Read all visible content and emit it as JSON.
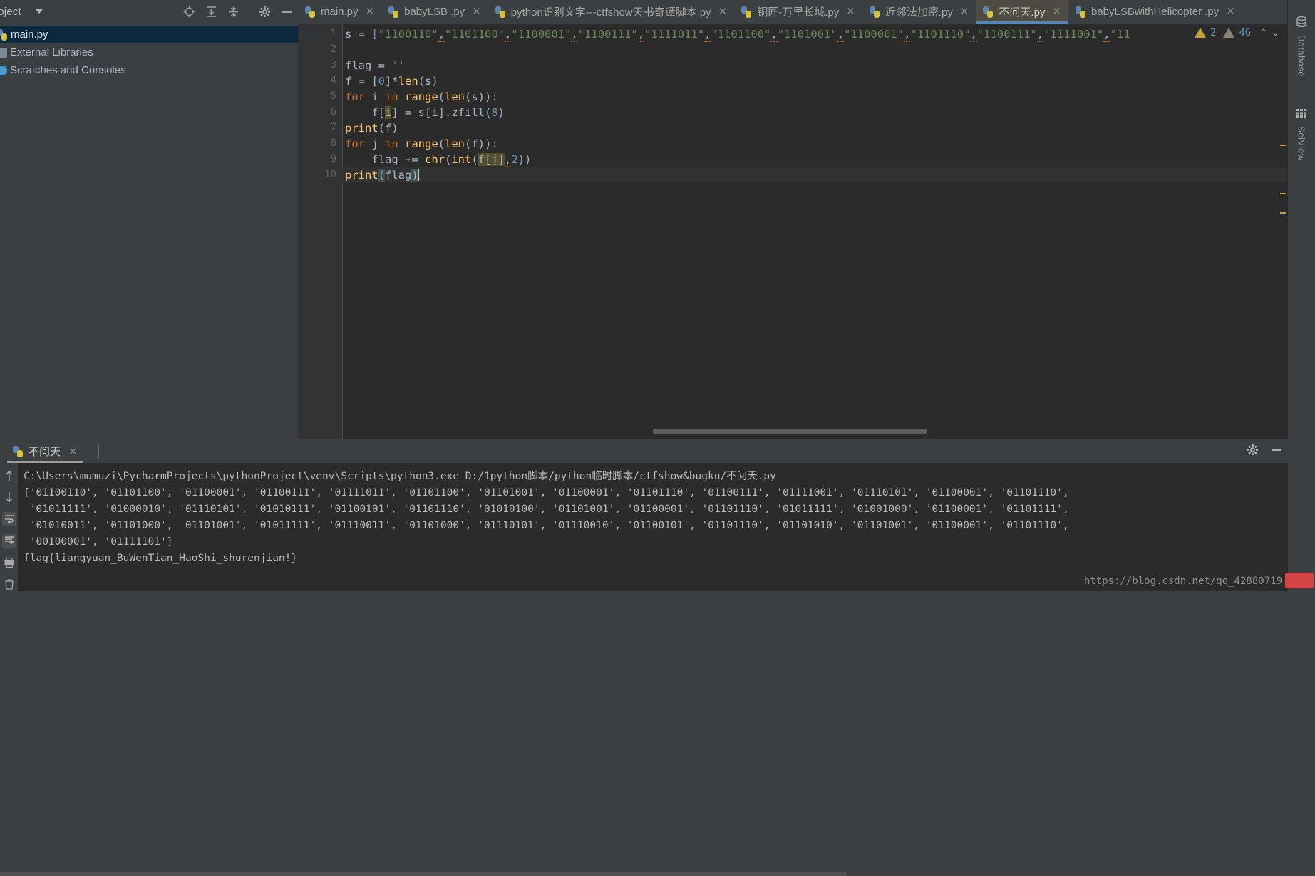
{
  "project_panel": {
    "title": "roject",
    "caret_icon": "chevron-down-icon",
    "toolbar": [
      {
        "name": "locate-icon",
        "glyph": "⊕"
      },
      {
        "name": "expand-all-icon",
        "glyph": "⤓"
      },
      {
        "name": "collapse-all-icon",
        "glyph": "⤒"
      },
      {
        "name": "settings-gear-icon",
        "glyph": "✷"
      },
      {
        "name": "hide-panel-icon",
        "glyph": "—"
      }
    ],
    "tree": [
      {
        "label": "main.py",
        "icon": "python-file-icon",
        "selected": true
      },
      {
        "label": "External Libraries",
        "icon": "library-icon",
        "selected": false
      },
      {
        "label": "Scratches and Consoles",
        "icon": "scratches-icon",
        "selected": false
      }
    ]
  },
  "editor_tabs": [
    {
      "label": "main.py",
      "active": false
    },
    {
      "label": "babyLSB .py",
      "active": false
    },
    {
      "label": "python识别文字---ctfshow天书奇谭脚本.py",
      "active": false
    },
    {
      "label": "铜匠-万里长城.py",
      "active": false
    },
    {
      "label": "近邻法加密.py",
      "active": false
    },
    {
      "label": "不问天.py",
      "active": true
    },
    {
      "label": "babyLSBwithHelicopter .py",
      "active": false
    }
  ],
  "inspection_widget": {
    "warning_count": "2",
    "weak_warning_count": "46",
    "prev_icon": "chevron-up-icon",
    "next_icon": "chevron-down-icon"
  },
  "editor": {
    "line_numbers": [
      "1",
      "2",
      "3",
      "4",
      "5",
      "6",
      "7",
      "8",
      "9",
      "10"
    ],
    "code_lines": [
      "s = [\"1100110\",\"1101100\",\"1100001\",\"1100111\",\"1111011\",\"1101100\",\"1101001\",\"1100001\",\"1101110\",\"1100111\",\"1111001\",\"11",
      "",
      "flag = ''",
      "f = [0]*len(s)",
      "for i in range(len(s)):",
      "    f[i] = s[i].zfill(8)",
      "print(f)",
      "for j in range(len(f)):",
      "    flag += chr(int(f[j],2))",
      "print(flag)"
    ],
    "caret_line": "10"
  },
  "right_stripe": [
    {
      "label": "Database",
      "icon": "database-icon"
    },
    {
      "label": "SciView",
      "icon": "grid-icon"
    }
  ],
  "run_panel": {
    "tab_label": "不问天",
    "tab_icon": "python-run-icon",
    "close_icon": "close-icon",
    "toolbar": [
      {
        "name": "settings-gear-icon",
        "glyph": "✷"
      },
      {
        "name": "hide-panel-icon",
        "glyph": "—"
      }
    ],
    "side_tools": [
      {
        "name": "scroll-up-icon",
        "glyph": "↑"
      },
      {
        "name": "scroll-down-icon",
        "glyph": "↓"
      },
      {
        "name": "soft-wrap-icon",
        "glyph": "⇥"
      },
      {
        "name": "scroll-to-end-icon",
        "glyph": "⇟"
      },
      {
        "name": "print-icon",
        "glyph": "⎙"
      },
      {
        "name": "clear-all-icon",
        "glyph": "🗑"
      }
    ],
    "console_lines": [
      "C:\\Users\\mumuzi\\PycharmProjects\\pythonProject\\venv\\Scripts\\python3.exe D:/1python脚本/python临时脚本/ctfshow&bugku/不问天.py",
      "['01100110', '01101100', '01100001', '01100111', '01111011', '01101100', '01101001', '01100001', '01101110', '01100111', '01111001', '01110101', '01100001', '01101110',",
      " '01011111', '01000010', '01110101', '01010111', '01100101', '01101110', '01010100', '01101001', '01100001', '01101110', '01011111', '01001000', '01100001', '01101111',",
      " '01010011', '01101000', '01101001', '01011111', '01110011', '01101000', '01110101', '01110010', '01100101', '01101110', '01101010', '01101001', '01100001', '01101110',",
      " '00100001', '01111101']",
      "flag{liangyuan_BuWenTian_HaoShi_shurenjian!}"
    ]
  },
  "watermark": {
    "text": "https://blog.csdn.net/qq_42880719"
  },
  "colors": {
    "accent_blue": "#4a88c7",
    "editor_bg": "#2b2b2b",
    "panel_bg": "#3c3f41",
    "selection_blue": "#0d293e",
    "string_green": "#6a8759",
    "keyword_orange": "#cc7832",
    "number_blue": "#6897bb",
    "warning_yellow": "#c9a033"
  }
}
